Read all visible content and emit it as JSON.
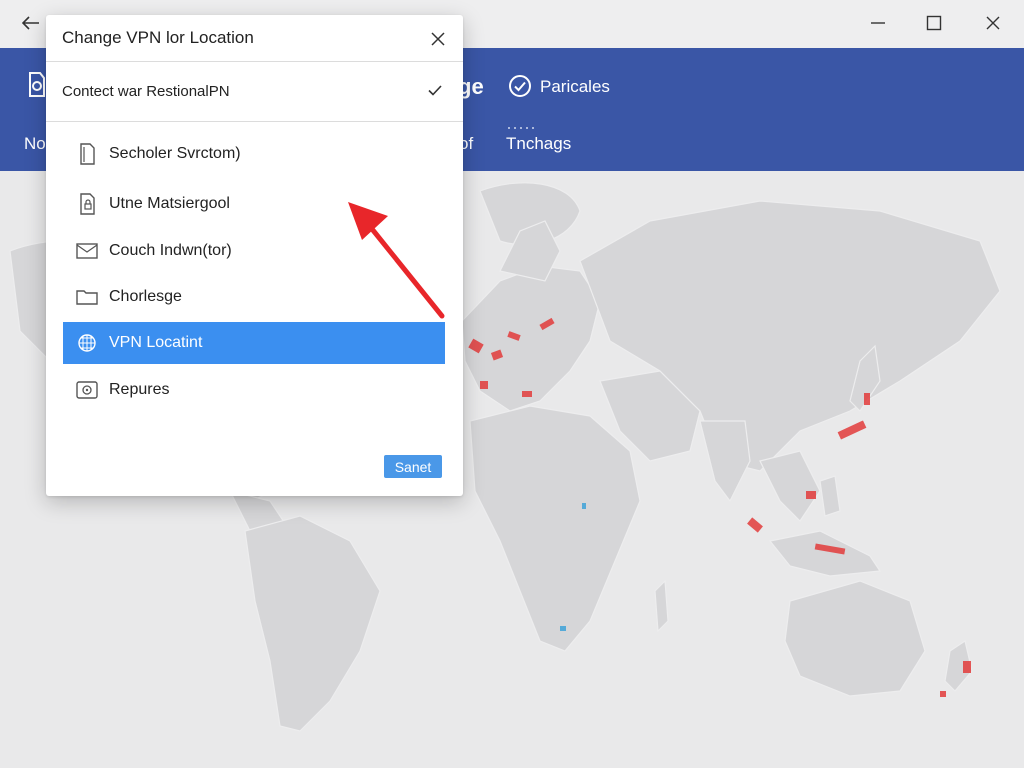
{
  "window": {
    "back_icon": "arrow-left-icon",
    "minimize_icon": "minimize-icon",
    "maximize_icon": "maximize-icon",
    "close_icon": "close-icon"
  },
  "header": {
    "partial_title": "ge",
    "title": "Paricales",
    "nav": {
      "left_stub": "No",
      "mid_stub": "of",
      "tab": "Tnchags"
    },
    "colors": {
      "background": "#3a56a6"
    }
  },
  "dialog": {
    "title": "Change VPN lor Location",
    "selected": "Contect war RestionalPN",
    "options": [
      {
        "label": "Secholer Svrctom)",
        "icon": "document-icon"
      },
      {
        "label": "Utne Matsiergool",
        "icon": "file-lock-icon"
      },
      {
        "label": "Couch Indwn(tor)",
        "icon": "envelope-icon"
      },
      {
        "label": "Chorlesge",
        "icon": "folder-icon"
      },
      {
        "label": "VPN Locatint",
        "icon": "globe-grid-icon",
        "active": true
      },
      {
        "label": "Repures",
        "icon": "image-gear-icon"
      }
    ],
    "save_label": "Sanet",
    "colors": {
      "active": "#3b8ff0",
      "save": "#4a98e8"
    }
  },
  "annotation": {
    "color": "#e8262a",
    "icon": "red-arrow-pointer"
  }
}
